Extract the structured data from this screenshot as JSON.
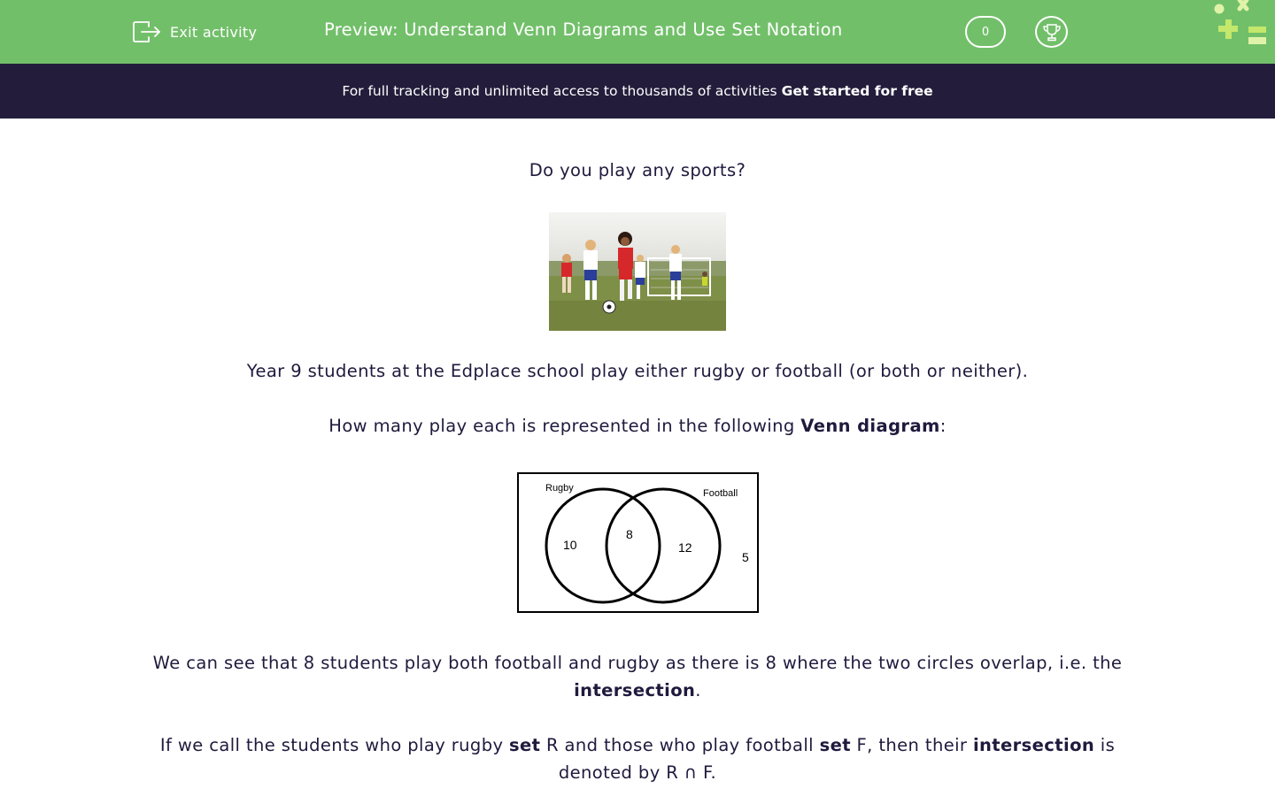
{
  "header": {
    "exit_label": "Exit activity",
    "title": "Preview: Understand Venn Diagrams and Use Set Notation",
    "score": "0",
    "icons": [
      "exit-icon",
      "trophy-icon",
      "edplace-logo-icon"
    ]
  },
  "banner": {
    "text": "For full tracking and unlimited access to thousands of activities",
    "cta": "Get started for free"
  },
  "lesson": {
    "question": "Do you play any sports?",
    "p1": "Year 9 students at the Edplace school play either rugby or football (or both or neither).",
    "p2": {
      "a": "How many play each is represented in the following ",
      "b": "Venn diagram",
      "c": ":"
    },
    "p3": {
      "a": "We can see that 8 students play both football and rugby as there is 8 where the two circles overlap, i.e. the ",
      "b": "intersection",
      "c": "."
    },
    "p4": {
      "a": "If we call the students who play rugby ",
      "b": "set",
      "c": " R and those who play football ",
      "d": "set",
      "e": " F, then their ",
      "f": "intersection",
      "g": " is denoted by R ∩ F."
    }
  },
  "venn": {
    "label_left": "Rugby",
    "label_right": "Football",
    "only_left": "10",
    "both": "8",
    "only_right": "12",
    "outside": "5"
  },
  "colors": {
    "header_green": "#72bf6a",
    "banner_navy": "#231d3b",
    "text": "#1f1a3d",
    "logo_lime": "#c3e86b"
  }
}
